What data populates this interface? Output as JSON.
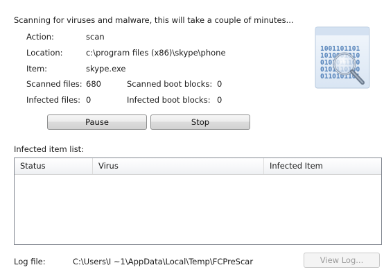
{
  "header": {
    "message": "Scanning for viruses and malware, this will take a couple of minutes..."
  },
  "details": {
    "action_label": "Action:",
    "action_value": "scan",
    "location_label": "Location:",
    "location_value": "c:\\program files (x86)\\skype\\phone",
    "item_label": "Item:",
    "item_value": "skype.exe",
    "scanned_files_label": "Scanned files:",
    "scanned_files_value": "680",
    "scanned_boot_label": "Scanned boot blocks:",
    "scanned_boot_value": "0",
    "infected_files_label": "Infected files:",
    "infected_files_value": "0",
    "infected_boot_label": "Infected boot blocks:",
    "infected_boot_value": "0"
  },
  "buttons": {
    "pause": "Pause",
    "stop": "Stop",
    "view_log": "View Log..."
  },
  "infected_list": {
    "label": "Infected item list:",
    "columns": [
      "Status",
      "Virus",
      "Infected Item"
    ],
    "rows": []
  },
  "log": {
    "label": "Log file:",
    "path": "C:\\Users\\I          ~1\\AppData\\Local\\Temp\\FCPreScar"
  },
  "icon": {
    "name": "binary-magnifier-icon",
    "binary_lines": [
      "1001101101",
      "1010001010",
      "0101011100",
      "0101110100",
      "0110101101"
    ]
  },
  "colors": {
    "icon_blue": "#4f7fb8",
    "icon_bg": "#e3ecf6"
  }
}
